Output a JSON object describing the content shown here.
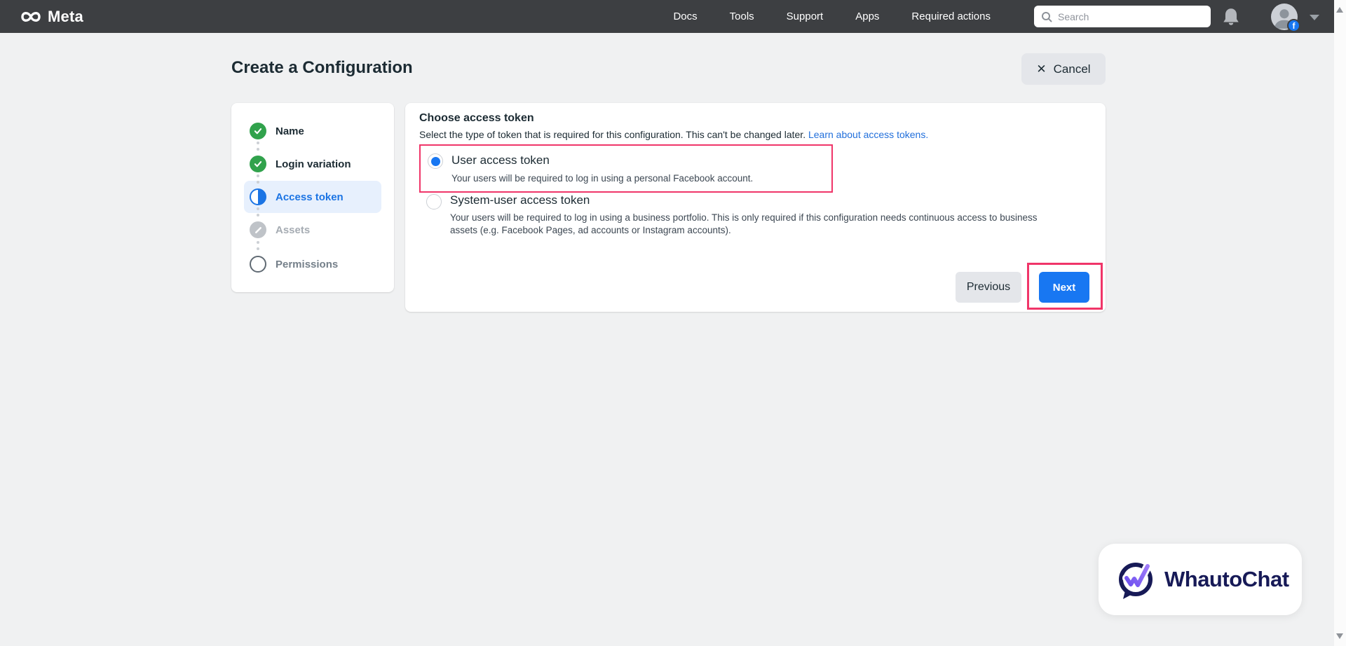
{
  "navbar": {
    "brand": "Meta",
    "links": [
      "Docs",
      "Tools",
      "Support",
      "Apps",
      "Required actions"
    ],
    "search": {
      "placeholder": "Search"
    }
  },
  "header": {
    "title": "Create a Configuration",
    "cancel_label": "Cancel"
  },
  "stepper": {
    "steps": [
      {
        "label": "Name",
        "state": "complete"
      },
      {
        "label": "Login variation",
        "state": "complete"
      },
      {
        "label": "Access token",
        "state": "active"
      },
      {
        "label": "Assets",
        "state": "disabled"
      },
      {
        "label": "Permissions",
        "state": "upcoming"
      }
    ]
  },
  "panel": {
    "heading": "Choose access token",
    "description": "Select the type of token that is required for this configuration. This can't be changed later.",
    "link_label": "Learn about access tokens.",
    "options": [
      {
        "label": "User access token",
        "description": "Your users will be required to log in using a personal Facebook account.",
        "selected": true,
        "annotated": true
      },
      {
        "label": "System-user access token",
        "description": "Your users will be required to log in using a business portfolio. This is only required if this configuration needs continuous access to business assets (e.g. Facebook Pages, ad accounts or Instagram accounts).",
        "selected": false,
        "annotated": false
      }
    ],
    "buttons": {
      "previous": "Previous",
      "next": "Next"
    }
  },
  "watermark": {
    "brand": "WhautoChat"
  },
  "colors": {
    "navbar_bg": "#3d3f42",
    "accent_blue": "#1877f2",
    "success_green": "#31a24c",
    "link_blue": "#216fdb",
    "annotation_pink": "#f03569",
    "active_step_bg": "#e7f0fd"
  }
}
